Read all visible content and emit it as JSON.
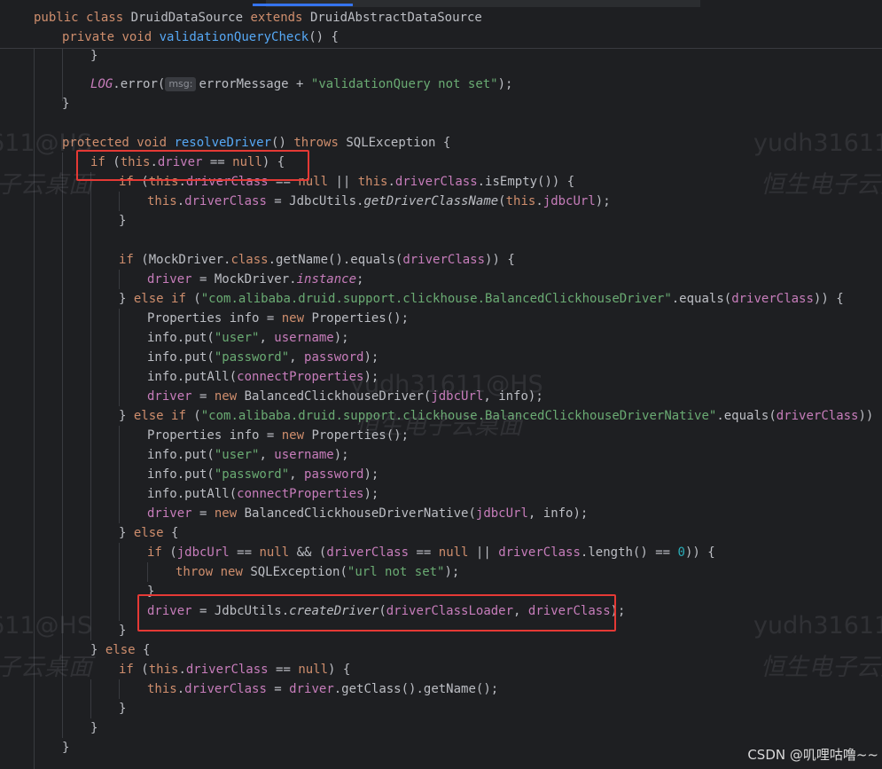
{
  "editor": {
    "sticky": {
      "class_line": {
        "kw1": "public",
        "kw2": "class",
        "name": "DruidDataSource",
        "kw3": "extends",
        "parent": "DruidAbstractDataSource"
      },
      "method_line": {
        "kw1": "private",
        "kw2": "void",
        "name": "validationQueryCheck",
        "rest": "() {"
      }
    },
    "code": {
      "l0": "}",
      "l1": {
        "log": "LOG",
        "call": ".error(",
        "hint": "msg:",
        "arg": "errorMessage + ",
        "str": "\"validationQuery not set\"",
        "end": ");"
      },
      "l2": "}",
      "l4": {
        "kw1": "protected",
        "kw2": "void",
        "fn": "resolveDriver",
        "mid": "() ",
        "kw3": "throws",
        "rest": " SQLException {"
      },
      "l5": {
        "kw1": "if",
        "p1": " (",
        "kw2": "this",
        "dot": ".",
        "fld": "driver",
        "op": " == ",
        "kw3": "null",
        "end": ") {"
      },
      "l6": {
        "kw1": "if",
        "p1": " (",
        "kw2": "this",
        "dot": ".",
        "fld": "driverClass",
        "op": " == ",
        "kw3": "null",
        "or": " || ",
        "kw4": "this",
        "dot2": ".",
        "fld2": "driverClass",
        "end": ".isEmpty()) {"
      },
      "l7": {
        "kw1": "this",
        "dot": ".",
        "fld": "driverClass",
        "mid": " = JdbcUtils.",
        "fn": "getDriverClassName",
        "p": "(",
        "kw2": "this",
        "dot2": ".",
        "fld2": "jdbcUrl",
        "end": ");"
      },
      "l8": "}",
      "l10": {
        "kw1": "if",
        "p1": " (MockDriver.",
        "kw2": "class",
        "mid": ".getName().equals(",
        "fld": "driverClass",
        "end": ")) {"
      },
      "l11": {
        "fld": "driver",
        "mid": " = MockDriver.",
        "st": "instance",
        "end": ";"
      },
      "l12": {
        "b": "} ",
        "kw1": "else",
        "sp": " ",
        "kw2": "if",
        "p": " (",
        "str": "\"com.alibaba.druid.support.clickhouse.BalancedClickhouseDriver\"",
        "mid": ".equals(",
        "fld": "driverClass",
        "end": ")) {"
      },
      "l13": {
        "a": "Properties info = ",
        "kw": "new",
        "b": " Properties();"
      },
      "l14": {
        "a": "info.put(",
        "str": "\"user\"",
        "c": ", ",
        "fld": "username",
        "e": ");"
      },
      "l15": {
        "a": "info.put(",
        "str": "\"password\"",
        "c": ", ",
        "fld": "password",
        "e": ");"
      },
      "l16": {
        "a": "info.putAll(",
        "fld": "connectProperties",
        "e": ");"
      },
      "l17": {
        "fld": "driver",
        "a": " = ",
        "kw": "new",
        "b": " BalancedClickhouseDriver(",
        "fld2": "jdbcUrl",
        "e": ", info);"
      },
      "l18": {
        "b": "} ",
        "kw1": "else",
        "sp": " ",
        "kw2": "if",
        "p": " (",
        "str": "\"com.alibaba.druid.support.clickhouse.BalancedClickhouseDriverNative\"",
        "mid": ".equals(",
        "fld": "driverClass",
        "end": ")) {"
      },
      "l19": {
        "a": "Properties info = ",
        "kw": "new",
        "b": " Properties();"
      },
      "l20": {
        "a": "info.put(",
        "str": "\"user\"",
        "c": ", ",
        "fld": "username",
        "e": ");"
      },
      "l21": {
        "a": "info.put(",
        "str": "\"password\"",
        "c": ", ",
        "fld": "password",
        "e": ");"
      },
      "l22": {
        "a": "info.putAll(",
        "fld": "connectProperties",
        "e": ");"
      },
      "l23": {
        "fld": "driver",
        "a": " = ",
        "kw": "new",
        "b": " BalancedClickhouseDriverNative(",
        "fld2": "jdbcUrl",
        "e": ", info);"
      },
      "l24": {
        "b": "} ",
        "kw": "else",
        "e": " {"
      },
      "l25": {
        "kw1": "if",
        "p": " (",
        "fld": "jdbcUrl",
        "op": " == ",
        "kw2": "null",
        "and": " && (",
        "fld2": "driverClass",
        "op2": " == ",
        "kw3": "null",
        "or": " || ",
        "fld3": "driverClass",
        "m": ".length() == ",
        "num": "0",
        "e": ")) {"
      },
      "l26": {
        "kw1": "throw",
        "sp": " ",
        "kw2": "new",
        "b": " SQLException(",
        "str": "\"url not set\"",
        "e": ");"
      },
      "l27": "}",
      "l28": {
        "fld": "driver",
        "a": " = JdbcUtils.",
        "fn": "createDriver",
        "p": "(",
        "fld2": "driverClassLoader",
        "c": ", ",
        "fld3": "driverClass",
        "e": ");"
      },
      "l29": "}",
      "l30": {
        "b": "} ",
        "kw": "else",
        "e": " {"
      },
      "l31": {
        "kw1": "if",
        "p": " (",
        "kw2": "this",
        "dot": ".",
        "fld": "driverClass",
        "op": " == ",
        "kw3": "null",
        "e": ") {"
      },
      "l32": {
        "kw": "this",
        "dot": ".",
        "fld": "driverClass",
        "a": " = ",
        "fld2": "driver",
        "e": ".getClass().getName();"
      },
      "l33": "}",
      "l34": "}",
      "l35": "}"
    }
  },
  "watermarks": {
    "w1": "yudh31611@HS",
    "w2": "恒生电子云桌面",
    "w3": "611@HS",
    "w4": "子云桌面"
  },
  "footer": {
    "csdn": "CSDN @叽哩咕噜~~"
  },
  "colors": {
    "highlight": "#e53935",
    "keyword": "#cf8e6d",
    "field": "#c77dbb",
    "string": "#6aab73",
    "function": "#56a8f5"
  }
}
